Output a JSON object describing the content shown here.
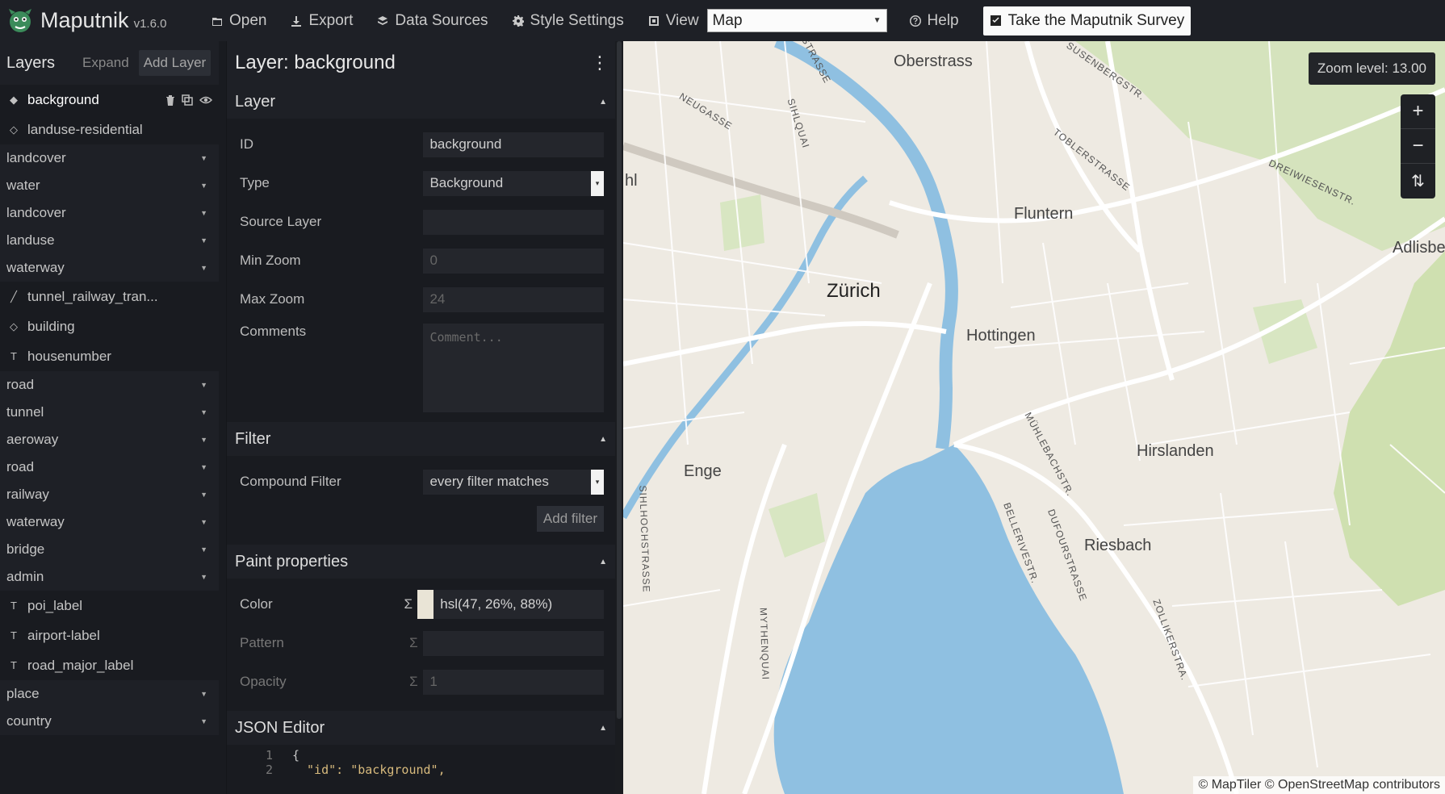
{
  "app": {
    "name": "Maputnik",
    "version": "v1.6.0"
  },
  "toolbar": {
    "open": "Open",
    "export": "Export",
    "data_sources": "Data Sources",
    "style_settings": "Style Settings",
    "view": "View",
    "view_value": "Map",
    "help": "Help",
    "survey": "Take the Maputnik Survey"
  },
  "layers_panel": {
    "title": "Layers",
    "expand": "Expand",
    "add_layer": "Add Layer",
    "items": [
      {
        "kind": "layer",
        "icon": "fill-icon",
        "label": "background",
        "selected": true
      },
      {
        "kind": "layer",
        "icon": "fill-outline-icon",
        "label": "landuse-residential"
      },
      {
        "kind": "group",
        "label": "landcover"
      },
      {
        "kind": "group",
        "label": "water"
      },
      {
        "kind": "group",
        "label": "landcover"
      },
      {
        "kind": "group",
        "label": "landuse"
      },
      {
        "kind": "group",
        "label": "waterway"
      },
      {
        "kind": "layer",
        "icon": "line-icon",
        "label": "tunnel_railway_tran..."
      },
      {
        "kind": "layer",
        "icon": "fill-outline-icon",
        "label": "building"
      },
      {
        "kind": "layer",
        "icon": "symbol-icon",
        "label": "housenumber"
      },
      {
        "kind": "group",
        "label": "road"
      },
      {
        "kind": "group",
        "label": "tunnel"
      },
      {
        "kind": "group",
        "label": "aeroway"
      },
      {
        "kind": "group",
        "label": "road"
      },
      {
        "kind": "group",
        "label": "railway"
      },
      {
        "kind": "group",
        "label": "waterway"
      },
      {
        "kind": "group",
        "label": "bridge"
      },
      {
        "kind": "group",
        "label": "admin"
      },
      {
        "kind": "layer",
        "icon": "symbol-icon",
        "label": "poi_label"
      },
      {
        "kind": "layer",
        "icon": "symbol-icon",
        "label": "airport-label"
      },
      {
        "kind": "layer",
        "icon": "symbol-icon",
        "label": "road_major_label"
      },
      {
        "kind": "group",
        "label": "place"
      },
      {
        "kind": "group",
        "label": "country"
      }
    ]
  },
  "editor": {
    "title": "Layer: background",
    "layer_section": {
      "title": "Layer",
      "id_label": "ID",
      "id_value": "background",
      "type_label": "Type",
      "type_value": "Background",
      "source_layer_label": "Source Layer",
      "source_layer_value": "",
      "min_zoom_label": "Min Zoom",
      "min_zoom_value": "0",
      "max_zoom_label": "Max Zoom",
      "max_zoom_value": "24",
      "comments_label": "Comments",
      "comments_placeholder": "Comment..."
    },
    "filter_section": {
      "title": "Filter",
      "compound_label": "Compound Filter",
      "compound_value": "every filter matches",
      "add_filter": "Add filter"
    },
    "paint_section": {
      "title": "Paint properties",
      "color_label": "Color",
      "color_value": "hsl(47, 26%, 88%)",
      "color_swatch": "#e9e4d6",
      "pattern_label": "Pattern",
      "pattern_value": "",
      "opacity_label": "Opacity",
      "opacity_value": "1",
      "sigma": "Σ"
    },
    "json_section": {
      "title": "JSON Editor",
      "lines": [
        {
          "n": "1",
          "text": "{"
        },
        {
          "n": "2",
          "text": "\"id\": \"background\","
        }
      ]
    }
  },
  "map": {
    "zoom_label": "Zoom level: 13.00",
    "zoom_in": "+",
    "zoom_out": "−",
    "compass": "⇅",
    "attribution": "© MapTiler © OpenStreetMap contributors",
    "places": [
      "Oberstrass",
      "Fluntern",
      "Zürich",
      "Hottingen",
      "Enge",
      "Hirslanden",
      "Riesbach",
      "Adlisbe",
      "hl"
    ],
    "streets": [
      "OSTRASSE",
      "SUSENBERGSTR.",
      "NEUGASSE",
      "SIHLQUAI",
      "TOBLERSTRASSE",
      "DREIWIESENSTR.",
      "MÜHLEBACHSTR.",
      "SIHLHOCHSTRASSE",
      "BELLERIVESTR.",
      "DUFOURSTRASSE",
      "MYTHENQUAI",
      "ZOLLIKERSTRA."
    ]
  },
  "colors": {
    "panel_bg": "#191b20",
    "header_bg": "#1e2026",
    "water": "#8fc0e1",
    "park": "#cfe0b0",
    "land": "#eeeae2"
  }
}
